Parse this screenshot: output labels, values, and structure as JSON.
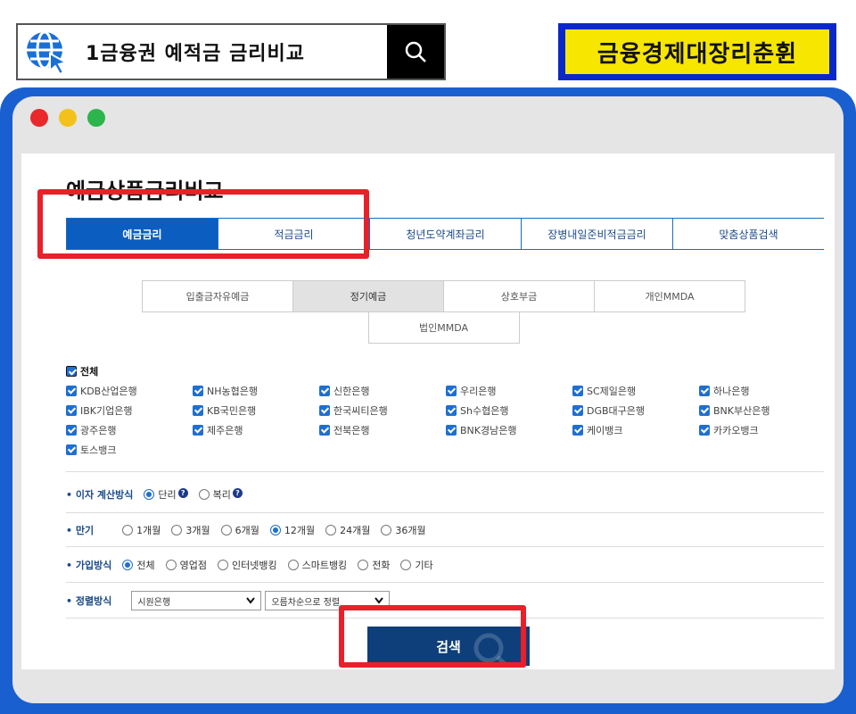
{
  "top": {
    "query": "1금융권 예적금 금리비교",
    "banner": "금융경제대장리춘휜"
  },
  "window": {
    "dots": [
      "#e8282a",
      "#f2c21a",
      "#2bb54a"
    ]
  },
  "page": {
    "title": "예금상품금리비교",
    "tabs": [
      {
        "label": "예금금리",
        "active": true
      },
      {
        "label": "적금금리",
        "active": false
      },
      {
        "label": "청년도약계좌금리",
        "active": false
      },
      {
        "label": "장병내일준비적금금리",
        "active": false
      },
      {
        "label": "맞춤상품검색",
        "active": false
      }
    ],
    "sub_tabs_row1": [
      "입출금자유예금",
      "정기예금",
      "상호부금",
      "개인MMDA"
    ],
    "sub_tabs_row2": [
      "법인MMDA"
    ],
    "sub_active": "정기예금",
    "all_label": "전체",
    "banks": [
      "KDB산업은행",
      "NH농협은행",
      "신한은행",
      "우리은행",
      "SC제일은행",
      "하나은행",
      "IBK기업은행",
      "KB국민은행",
      "한국씨티은행",
      "Sh수협은행",
      "DGB대구은행",
      "BNK부산은행",
      "광주은행",
      "제주은행",
      "전북은행",
      "BNK경남은행",
      "케이뱅크",
      "카카오뱅크",
      "토스뱅크"
    ],
    "interest": {
      "label": "• 이자 계산방식",
      "options": [
        "단리",
        "복리"
      ],
      "selected": "단리"
    },
    "term": {
      "label": "• 만기",
      "options": [
        "1개월",
        "3개월",
        "6개월",
        "12개월",
        "24개월",
        "36개월"
      ],
      "selected": "12개월"
    },
    "join": {
      "label": "• 가입방식",
      "options": [
        "전체",
        "영업점",
        "인터넷뱅킹",
        "스마트뱅킹",
        "전화",
        "기타"
      ],
      "selected": "전체"
    },
    "sort": {
      "label": "• 정렬방식",
      "select1": "시원은행",
      "select2": "오름차순으로 정렬"
    },
    "search_button": "검색"
  }
}
